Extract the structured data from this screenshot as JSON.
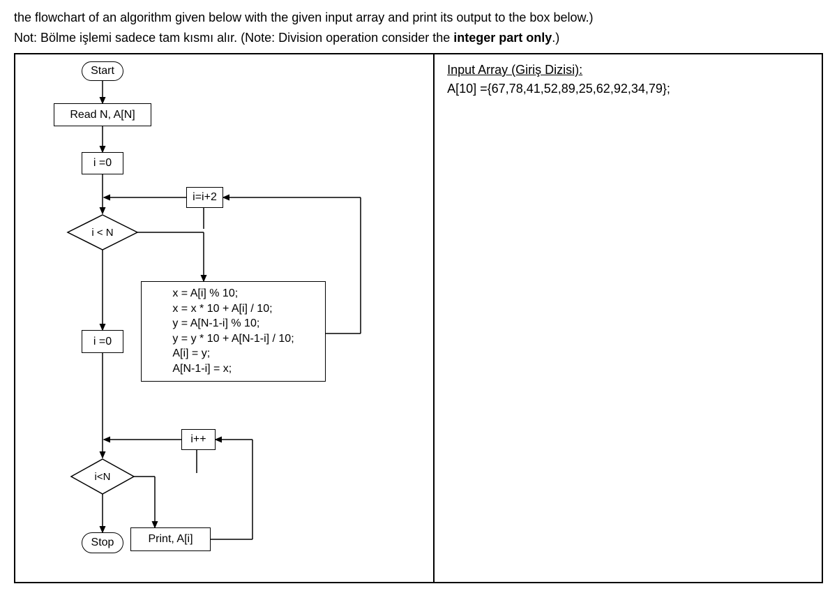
{
  "instructions": {
    "line1": "the flowchart of an algorithm given below with the given input array and print its output to the box below.)",
    "line2_prefix": "Not: Bölme işlemi sadece tam kısmı alır. (Note: Division operation consider the ",
    "line2_bold": "integer part only",
    "line2_suffix": ".)"
  },
  "input_panel": {
    "title": "Input Array (Giriş Dizisi):",
    "array": "A[10] ={67,78,41,52,89,25,62,92,34,79};"
  },
  "flowchart": {
    "start": "Start",
    "read": "Read N, A[N]",
    "init1": "i =0",
    "increment_outer": "i=i+2",
    "cond1": "i < N",
    "init2": "i =0",
    "code_lines": [
      "x = A[i] % 10;",
      "x = x * 10 + A[i] / 10;",
      "y = A[N-1-i] % 10;",
      "y = y * 10 + A[N-1-i] / 10;",
      "A[i] = y;",
      "A[N-1-i] = x;"
    ],
    "increment_inner": "i++",
    "cond2": "i<N",
    "print": "Print, A[i]",
    "stop": "Stop"
  }
}
